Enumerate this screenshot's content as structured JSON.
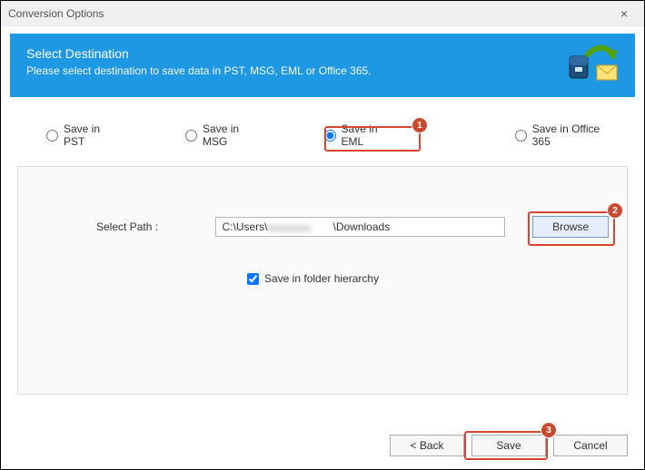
{
  "window": {
    "title": "Conversion Options"
  },
  "banner": {
    "title": "Select Destination",
    "subtitle": "Please select destination to save data in PST, MSG, EML or Office 365."
  },
  "formats": {
    "pst": "Save in PST",
    "msg": "Save in MSG",
    "eml": "Save in EML",
    "o365": "Save in Office 365",
    "selected": "eml"
  },
  "path": {
    "label": "Select Path :",
    "value_prefix": "C:\\Users\\",
    "value_suffix": "\\Downloads",
    "browse": "Browse"
  },
  "folder_hierarchy": {
    "label": "Save in folder hierarchy",
    "checked": true
  },
  "footer": {
    "back": "< Back",
    "save": "Save",
    "cancel": "Cancel"
  },
  "callouts": {
    "1": "1",
    "2": "2",
    "3": "3"
  }
}
